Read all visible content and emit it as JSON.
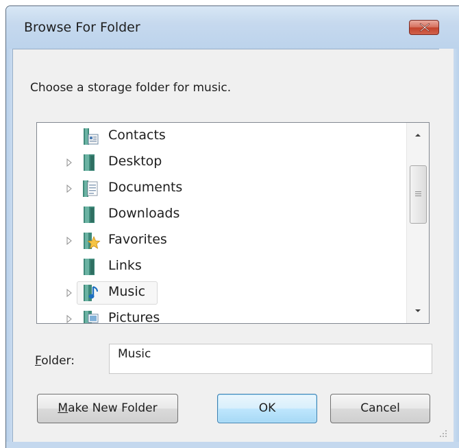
{
  "dialog": {
    "title": "Browse For Folder",
    "prompt": "Choose a storage folder for music."
  },
  "tree": {
    "items": [
      {
        "label": "Contacts",
        "icon": "contacts-folder-icon",
        "expandable": false,
        "selected": false
      },
      {
        "label": "Desktop",
        "icon": "folder-icon",
        "expandable": true,
        "selected": false
      },
      {
        "label": "Documents",
        "icon": "documents-folder-icon",
        "expandable": true,
        "selected": false
      },
      {
        "label": "Downloads",
        "icon": "folder-icon",
        "expandable": false,
        "selected": false
      },
      {
        "label": "Favorites",
        "icon": "favorites-folder-icon",
        "expandable": true,
        "selected": false
      },
      {
        "label": "Links",
        "icon": "folder-icon",
        "expandable": false,
        "selected": false
      },
      {
        "label": "Music",
        "icon": "music-folder-icon",
        "expandable": true,
        "selected": true
      },
      {
        "label": "Pictures",
        "icon": "pictures-folder-icon",
        "expandable": true,
        "selected": false
      }
    ]
  },
  "folder_field": {
    "label_access_key": "F",
    "label_rest": "older:",
    "value": "Music"
  },
  "buttons": {
    "make_new_folder_access_key": "M",
    "make_new_folder_rest": "ake New Folder",
    "ok": "OK",
    "cancel": "Cancel"
  },
  "colors": {
    "title_bar": "#c6d9ee",
    "close_button": "#c3432c",
    "default_button_border": "#3c7fb1"
  }
}
